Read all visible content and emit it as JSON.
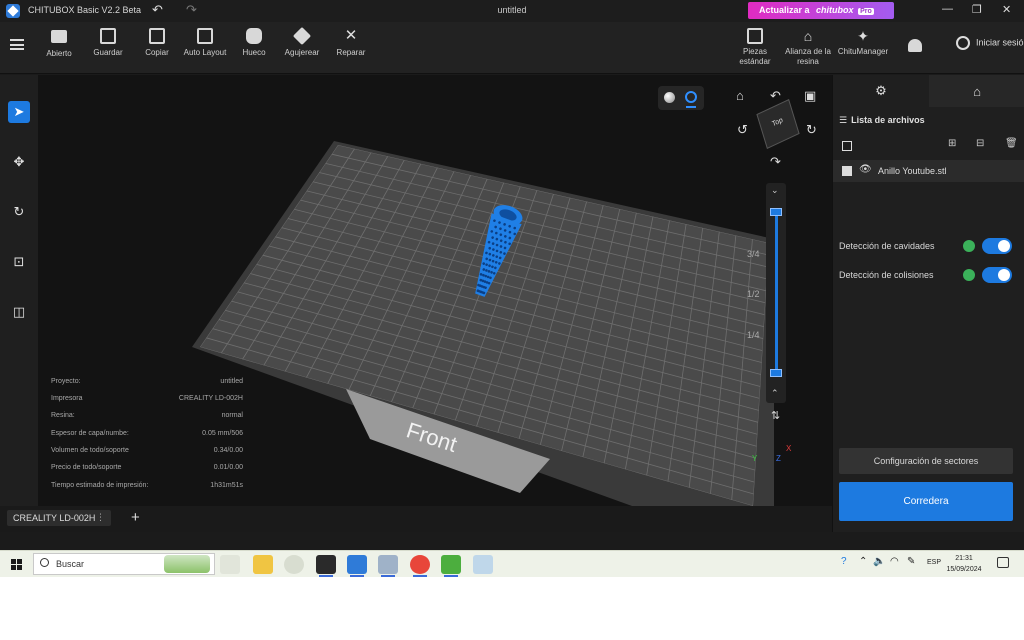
{
  "titlebar": {
    "app_title": "CHITUBOX Basic V2.2 Beta",
    "document_title": "untitled",
    "upgrade_label": "Actualizar a",
    "upgrade_brand": "chitubox",
    "upgrade_badge": "Pro"
  },
  "toolbar": {
    "items": [
      {
        "label": "Abierto",
        "icon": "folder-icon"
      },
      {
        "label": "Guardar",
        "icon": "save-icon"
      },
      {
        "label": "Copiar",
        "icon": "copy-icon"
      },
      {
        "label": "Auto Layout",
        "icon": "auto-layout-icon"
      },
      {
        "label": "Hueco",
        "icon": "hollow-icon"
      },
      {
        "label": "Agujerear",
        "icon": "drill-icon"
      },
      {
        "label": "Reparar",
        "icon": "repair-icon"
      }
    ],
    "right_items": [
      {
        "label_line1": "Piezas",
        "label_line2": "estándar",
        "icon": "parts-icon"
      },
      {
        "label_line1": "Alianza de la",
        "label_line2": "resina",
        "icon": "resin-alliance-icon"
      },
      {
        "label_line1": "ChituManager",
        "label_line2": "",
        "icon": "chitumanager-icon"
      }
    ],
    "login_label": "Iniciar sesión"
  },
  "viewport": {
    "front_label": "Front",
    "cube_label": "Top",
    "layer_fractions": [
      "3/4",
      "1/2",
      "1/4"
    ],
    "axes": {
      "x": "X",
      "y": "Y",
      "z": "Z"
    }
  },
  "info": [
    {
      "label": "Proyecto:",
      "value": "untitled"
    },
    {
      "label": "Impresora",
      "value": "CREALITY LD-002H"
    },
    {
      "label": "Resina:",
      "value": "normal"
    },
    {
      "label": "Espesor de capa/numbe:",
      "value": "0.05 mm/506"
    },
    {
      "label": "Volumen de todo/soporte",
      "value": "0.34/0.00"
    },
    {
      "label": "Precio de todo/soporte",
      "value": "0.01/0.00"
    },
    {
      "label": "Tiempo estimado de impresión:",
      "value": "1h31m51s"
    }
  ],
  "right_panel": {
    "files_title": "Lista de archivos",
    "files": [
      {
        "name": "Anillo Youtube.stl"
      }
    ],
    "toggles": [
      {
        "label": "Detección de cavidades",
        "on": true
      },
      {
        "label": "Detección de colisiones",
        "on": true
      }
    ],
    "sector_button": "Configuración de sectores",
    "slice_button": "Corredera"
  },
  "bottom": {
    "printer_tab": "CREALITY LD-002H"
  },
  "taskbar": {
    "search_placeholder": "Buscar",
    "language": "ESP",
    "time": "21:31",
    "date": "15/09/2024"
  },
  "colors": {
    "accent": "#1d7ae0",
    "model": "#1f7fe6",
    "plate": "#4a4a4a",
    "upgrade_gradient_start": "#e02bc2",
    "upgrade_gradient_end": "#a35cf0"
  }
}
